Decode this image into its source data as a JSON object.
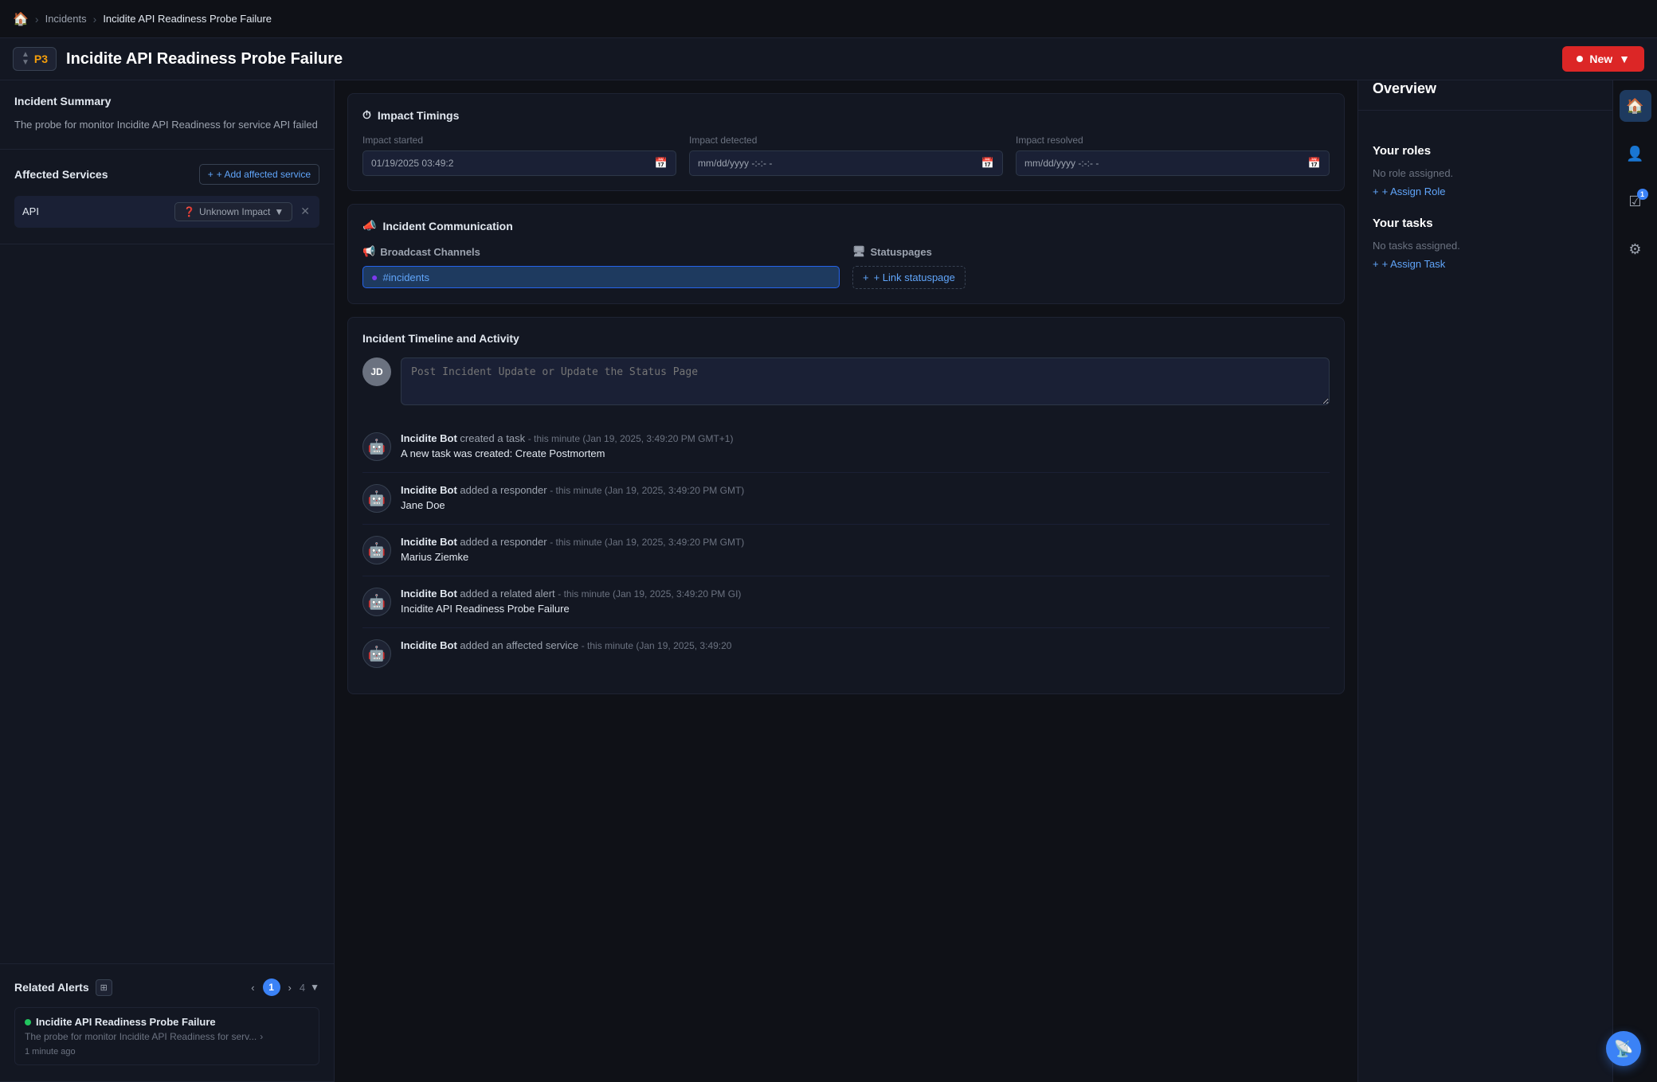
{
  "breadcrumb": {
    "home": "🏠",
    "items": [
      "Incidents",
      "Incidite API Readiness Probe Failure"
    ]
  },
  "incident": {
    "priority": "P3",
    "title": "Incidite API Readiness Probe Failure",
    "status": "New"
  },
  "summary": {
    "label": "Incident Summary",
    "text": "The probe for monitor Incidite API Readiness for service API failed"
  },
  "affected_services": {
    "label": "Affected Services",
    "add_btn": "+ Add affected service",
    "items": [
      {
        "name": "API",
        "impact": "Unknown Impact"
      }
    ]
  },
  "related_alerts": {
    "label": "Related Alerts",
    "current_page": "1",
    "total_pages": "4",
    "items": [
      {
        "name": "Incidite API Readiness Probe Failure",
        "desc": "The probe for monitor Incidite API Readiness for serv...",
        "time": "1 minute ago"
      }
    ]
  },
  "impact_timings": {
    "label": "Impact Timings",
    "fields": [
      {
        "label": "Impact started",
        "value": "01/19/2025 03:49:2"
      },
      {
        "label": "Impact detected",
        "value": "mm/dd/yyyy -:-:- -"
      },
      {
        "label": "Impact resolved",
        "value": "mm/dd/yyyy -:-:- -"
      }
    ]
  },
  "communication": {
    "label": "Incident Communication",
    "broadcast_label": "Broadcast Channels",
    "channels": [
      "#incidents"
    ],
    "statuspage_label": "Statuspages",
    "link_label": "+ Link statuspage"
  },
  "timeline": {
    "label": "Incident Timeline and Activity",
    "placeholder": "Post Incident Update or Update the Status Page",
    "user_initials": "JD",
    "entries": [
      {
        "actor": "Incidite Bot",
        "action": "created a task",
        "time": "- this minute (Jan 19, 2025, 3:49:20 PM GMT+1)",
        "body": "A new task was created: Create Postmortem"
      },
      {
        "actor": "Incidite Bot",
        "action": "added a responder",
        "time": "- this minute (Jan 19, 2025, 3:49:20 PM GMT)",
        "body": "Jane Doe"
      },
      {
        "actor": "Incidite Bot",
        "action": "added a responder",
        "time": "- this minute (Jan 19, 2025, 3:49:20 PM GMT)",
        "body": "Marius Ziemke"
      },
      {
        "actor": "Incidite Bot",
        "action": "added a related alert",
        "time": "- this minute (Jan 19, 2025, 3:49:20 PM GI)",
        "body": "Incidite API Readiness Probe Failure"
      },
      {
        "actor": "Incidite Bot",
        "action": "added an affected service",
        "time": "- this minute (Jan 19, 2025, 3:49:20",
        "body": ""
      }
    ]
  },
  "overview": {
    "label": "Overview",
    "roles": {
      "label": "Your roles",
      "empty": "No role assigned.",
      "assign_label": "+ Assign Role"
    },
    "tasks": {
      "label": "Your tasks",
      "empty": "No tasks assigned.",
      "assign_label": "+ Assign Task"
    }
  },
  "icon_bar": {
    "home_icon": "🏠",
    "user_icon": "👤",
    "task_icon": "☑",
    "task_badge": "1",
    "gear_icon": "⚙"
  },
  "float_btn": "📡"
}
